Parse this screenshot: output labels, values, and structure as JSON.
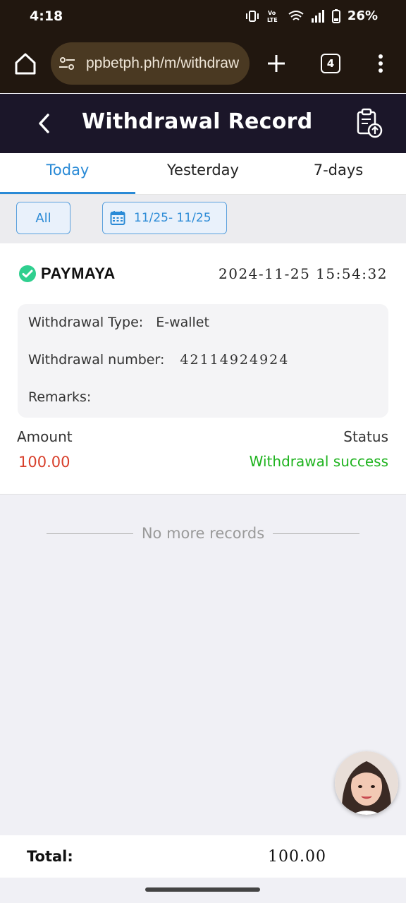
{
  "status_bar": {
    "time": "4:18",
    "battery": "26%",
    "net_label_top": "VoLTE",
    "net_label_bottom": "LTE"
  },
  "browser": {
    "url": "ppbetph.ph/m/withdraw",
    "tab_count": "4"
  },
  "header": {
    "title": "Withdrawal Record"
  },
  "tabs": [
    {
      "label": "Today",
      "active": true
    },
    {
      "label": "Yesterday",
      "active": false
    },
    {
      "label": "7-days",
      "active": false
    }
  ],
  "filters": {
    "all_label": "All",
    "date_range": "11/25- 11/25"
  },
  "record": {
    "provider": "PAYMAYA",
    "datetime": "2024-11-25 15:54:32",
    "type_label": "Withdrawal Type:",
    "type_value": "E-wallet",
    "number_label": "Withdrawal number:",
    "number_value": "42114924924",
    "remarks_label": "Remarks:",
    "amount_label": "Amount",
    "amount_value": "100.00",
    "status_label": "Status",
    "status_value": "Withdrawal success"
  },
  "list_end": "No more records",
  "footer": {
    "total_label": "Total:",
    "total_value": "100.00"
  },
  "colors": {
    "accent": "#2a8ad6",
    "success": "#1fb31f",
    "amount": "#d8402c",
    "header_bg": "#1b1629",
    "browser_bg": "#21170f"
  }
}
